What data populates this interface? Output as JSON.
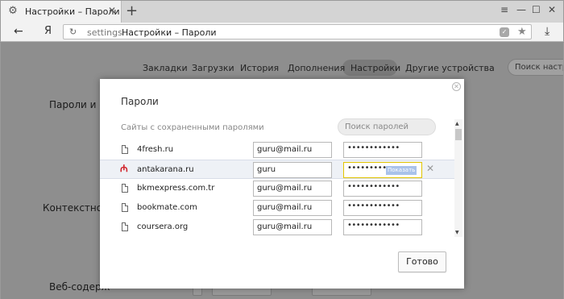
{
  "browser": {
    "tab_title": "Настройки – Пароли",
    "tab_close": "✕",
    "newtab": "+",
    "back": "←",
    "logo": "Я",
    "reload": "↻",
    "host": "settings",
    "page_title": "Настройки – Пароли",
    "shield": "✓",
    "star": "★",
    "download": "⤓",
    "win_menu": "≡",
    "win_min": "—",
    "win_max": "☐",
    "win_close": "✕"
  },
  "settings_nav": {
    "items": [
      "Закладки",
      "Загрузки",
      "История",
      "Дополнения",
      "Настройки",
      "Другие устройства"
    ],
    "active": "Настройки",
    "search_placeholder": "Поиск настро"
  },
  "background_labels": {
    "passwords": "Пароли и фо",
    "context": "Контекстное м",
    "web": "Веб-содерж"
  },
  "dialog": {
    "title": "Пароли",
    "subtitle": "Сайты с сохраненными паролями",
    "search_placeholder": "Поиск паролей",
    "close": "✕",
    "remove": "✕",
    "show_label": "Показать",
    "rows": [
      {
        "site": "4fresh.ru",
        "login": "guru@mail.ru",
        "password": "••••••••••••",
        "selected": false
      },
      {
        "site": "antakarana.ru",
        "login": "guru",
        "password": "••••••••••••",
        "selected": true
      },
      {
        "site": "bkmexpress.com.tr",
        "login": "guru@mail.ru",
        "password": "••••••••••••",
        "selected": false
      },
      {
        "site": "bookmate.com",
        "login": "guru@mail.ru",
        "password": "••••••••••••",
        "selected": false
      },
      {
        "site": "coursera.org",
        "login": "guru@mail.ru",
        "password": "••••••••••••",
        "selected": false
      }
    ],
    "done_label": "Готово",
    "scroll_up": "▲",
    "scroll_down": "▼"
  }
}
